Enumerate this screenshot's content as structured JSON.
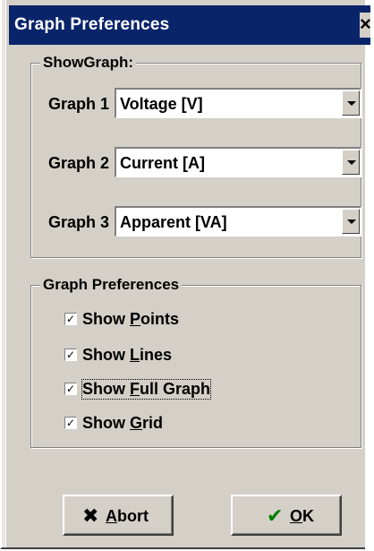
{
  "window": {
    "title": "Graph Preferences",
    "close_glyph": "×"
  },
  "show_graph": {
    "title": "ShowGraph:",
    "rows": [
      {
        "label": "Graph 1",
        "value": "Voltage [V]"
      },
      {
        "label": "Graph 2",
        "value": "Current [A]"
      },
      {
        "label": "Graph 3",
        "value": "Apparent [VA]"
      }
    ]
  },
  "preferences": {
    "title": "Graph Preferences",
    "items": [
      {
        "pre": "Show ",
        "accel": "P",
        "post": "oints",
        "checked": true
      },
      {
        "pre": "Show ",
        "accel": "L",
        "post": "ines",
        "checked": true
      },
      {
        "pre": "Show ",
        "accel": "F",
        "post": "ull Graph",
        "checked": true
      },
      {
        "pre": "Show ",
        "accel": "G",
        "post": "rid",
        "checked": true
      }
    ]
  },
  "buttons": {
    "abort": {
      "accel": "A",
      "rest": "bort",
      "icon": "x-icon"
    },
    "ok": {
      "accel": "O",
      "rest": "K",
      "icon": "checkmark-icon"
    }
  },
  "colors": {
    "titlebar": "#0a246a",
    "face": "#d4d0c8",
    "abort_icon": "#000000",
    "ok_icon": "#008000"
  }
}
